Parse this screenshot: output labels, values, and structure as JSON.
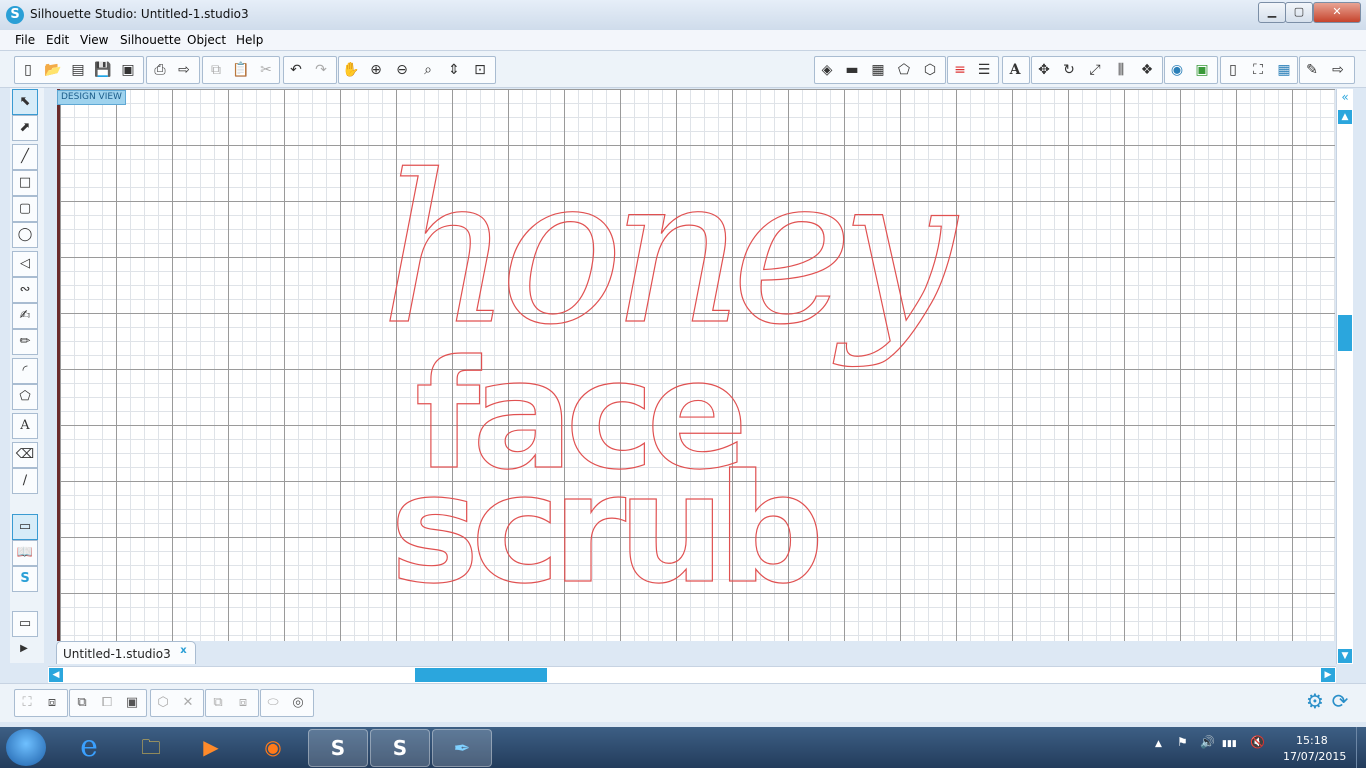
{
  "window": {
    "title": "Silhouette Studio: Untitled-1.studio3",
    "app_icon": "S",
    "controls": {
      "minimize": "▁",
      "maximize": "▢",
      "close": "✕"
    }
  },
  "menu": [
    "File",
    "Edit",
    "View",
    "Silhouette",
    "Object",
    "Help"
  ],
  "toolbar_left": [
    {
      "name": "new-icon",
      "glyph": "▯"
    },
    {
      "name": "open-icon",
      "glyph": "📂"
    },
    {
      "name": "template-icon",
      "glyph": "▤"
    },
    {
      "name": "save-icon",
      "glyph": "💾"
    },
    {
      "name": "save-library-icon",
      "glyph": "▣"
    },
    {
      "name": "print-icon",
      "glyph": "⎙"
    },
    {
      "name": "send-to-cutter-icon",
      "glyph": "⇨"
    },
    {
      "name": "copy-icon",
      "glyph": "⧉"
    },
    {
      "name": "paste-icon",
      "glyph": "📋"
    },
    {
      "name": "cut-icon",
      "glyph": "✂"
    },
    {
      "name": "undo-icon",
      "glyph": "↶"
    },
    {
      "name": "redo-icon",
      "glyph": "↷"
    },
    {
      "name": "pan-icon",
      "glyph": "✋"
    },
    {
      "name": "zoom-in-icon",
      "glyph": "⊕"
    },
    {
      "name": "zoom-out-icon",
      "glyph": "⊖"
    },
    {
      "name": "zoom-select-icon",
      "glyph": "⌕"
    },
    {
      "name": "drag-zoom-icon",
      "glyph": "⇕"
    },
    {
      "name": "fit-to-window-icon",
      "glyph": "⊡"
    }
  ],
  "toolbar_right": [
    {
      "name": "fill-color-icon",
      "glyph": "◈"
    },
    {
      "name": "fill-gradient-icon",
      "glyph": "▬"
    },
    {
      "name": "fill-pattern-icon",
      "glyph": "▦"
    },
    {
      "name": "line-color-icon",
      "glyph": "⬠"
    },
    {
      "name": "line-style-icon",
      "glyph": "⬡"
    },
    {
      "name": "line-color-bars-icon",
      "glyph": "≡"
    },
    {
      "name": "line-width-icon",
      "glyph": "☰"
    },
    {
      "name": "text-style-icon",
      "glyph": "A"
    },
    {
      "name": "transform-icon",
      "glyph": "✥"
    },
    {
      "name": "rotate-icon",
      "glyph": "↻"
    },
    {
      "name": "scale-icon",
      "glyph": "⤢"
    },
    {
      "name": "align-icon",
      "glyph": "⫼"
    },
    {
      "name": "replicate-icon",
      "glyph": "❖"
    },
    {
      "name": "modify-icon",
      "glyph": "◉"
    },
    {
      "name": "offset-icon",
      "glyph": "▣"
    },
    {
      "name": "page-setup-icon",
      "glyph": "▯"
    },
    {
      "name": "registration-icon",
      "glyph": "⛶"
    },
    {
      "name": "grid-icon",
      "glyph": "▦"
    },
    {
      "name": "cut-settings-icon",
      "glyph": "✎"
    },
    {
      "name": "send-icon",
      "glyph": "⇨"
    }
  ],
  "left_tools": [
    {
      "name": "select-tool-icon",
      "glyph": "⬉",
      "active": true
    },
    {
      "name": "point-edit-tool-icon",
      "glyph": "⬈"
    },
    {
      "name": "line-tool-icon",
      "glyph": "╱"
    },
    {
      "name": "rectangle-tool-icon",
      "glyph": "□"
    },
    {
      "name": "rounded-rectangle-tool-icon",
      "glyph": "▢"
    },
    {
      "name": "ellipse-tool-icon",
      "glyph": "◯"
    },
    {
      "name": "polygon-tool-icon",
      "glyph": "◁"
    },
    {
      "name": "curve-tool-icon",
      "glyph": "∾"
    },
    {
      "name": "freehand-tool-icon",
      "glyph": "✍"
    },
    {
      "name": "smooth-freehand-tool-icon",
      "glyph": "✏"
    },
    {
      "name": "arc-tool-icon",
      "glyph": "◜"
    },
    {
      "name": "regular-polygon-tool-icon",
      "glyph": "⬠"
    },
    {
      "name": "text-tool-icon",
      "glyph": "A"
    },
    {
      "name": "eraser-tool-icon",
      "glyph": "⌫"
    },
    {
      "name": "knife-tool-icon",
      "glyph": "∕"
    },
    {
      "name": "design-view-tool-icon",
      "glyph": "▭",
      "active": true
    },
    {
      "name": "library-tool-icon",
      "glyph": "📖"
    },
    {
      "name": "store-tool-icon",
      "glyph": "S"
    },
    {
      "name": "panel-tool-icon",
      "glyph": "▭"
    },
    {
      "name": "expand-arrow-icon",
      "glyph": "▶"
    }
  ],
  "canvas": {
    "view_label": "DESIGN VIEW",
    "art_lines": [
      "honey",
      "face",
      "scrub"
    ],
    "art_color": "#e05151"
  },
  "tabs": [
    {
      "label": "Untitled-1.studio3",
      "close": "x"
    }
  ],
  "scroll": {
    "up": "▲",
    "down": "▼",
    "left": "◀",
    "right": "▶",
    "collapse": "«"
  },
  "bottom_tools": [
    {
      "name": "group-icon",
      "glyph": "⛶"
    },
    {
      "name": "ungroup-icon",
      "glyph": "⧈"
    },
    {
      "name": "make-compound-icon",
      "glyph": "⧉"
    },
    {
      "name": "release-compound-icon",
      "glyph": "⧠"
    },
    {
      "name": "bring-to-front-icon",
      "glyph": "▣"
    },
    {
      "name": "weld-icon",
      "glyph": "⬡"
    },
    {
      "name": "delete-icon",
      "glyph": "✕"
    },
    {
      "name": "duplicate-icon",
      "glyph": "⧉"
    },
    {
      "name": "arrange-icon",
      "glyph": "⧈"
    },
    {
      "name": "library-save-icon",
      "glyph": "⬭"
    },
    {
      "name": "trace-icon",
      "glyph": "◎"
    }
  ],
  "bottom_right": [
    {
      "name": "settings-gear-icon",
      "glyph": "⚙"
    },
    {
      "name": "sync-icon",
      "glyph": "⟳"
    }
  ],
  "taskbar": {
    "items": [
      {
        "name": "ie-icon",
        "glyph": "e"
      },
      {
        "name": "explorer-icon",
        "glyph": "🗀"
      },
      {
        "name": "media-player-icon",
        "glyph": "▶"
      },
      {
        "name": "firefox-icon",
        "glyph": "◉"
      },
      {
        "name": "skype-icon",
        "glyph": "S",
        "open": true
      },
      {
        "name": "silhouette-taskbar-icon",
        "glyph": "S",
        "open": true
      },
      {
        "name": "quill-icon",
        "glyph": "✒",
        "open": true
      }
    ],
    "tray": [
      "▲",
      "⚑",
      "🔊",
      "▮▮▮",
      "🔇"
    ],
    "time": "15:18",
    "date": "17/07/2015"
  }
}
